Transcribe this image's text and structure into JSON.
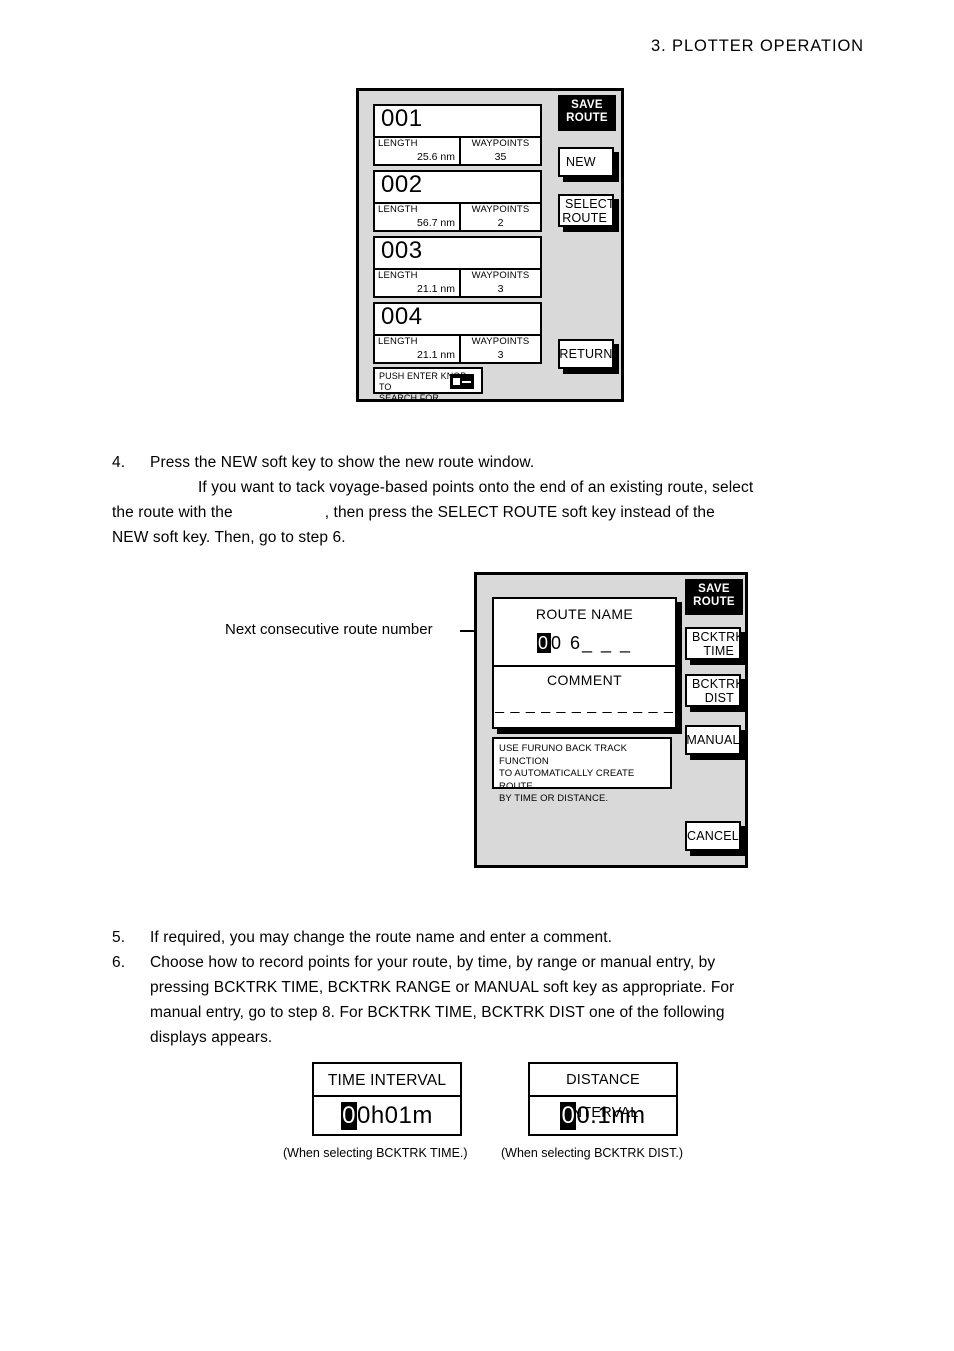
{
  "page": {
    "header": "3.  PLOTTER  OPERATION"
  },
  "figure_route_list": {
    "softkey_title": "SAVE\nROUTE",
    "softkey_title_line1": "SAVE",
    "softkey_title_line2": "ROUTE",
    "routes": [
      {
        "number": "001",
        "length_label": "LENGTH",
        "length_value": "25.6 nm",
        "waypoints_label": "WAYPOINTS",
        "waypoints_value": "35"
      },
      {
        "number": "002",
        "length_label": "LENGTH",
        "length_value": "56.7 nm",
        "waypoints_label": "WAYPOINTS",
        "waypoints_value": "2"
      },
      {
        "number": "003",
        "length_label": "LENGTH",
        "length_value": "21.1 nm",
        "waypoints_label": "WAYPOINTS",
        "waypoints_value": "3"
      },
      {
        "number": "004",
        "length_label": "LENGTH",
        "length_value": "21.1 nm",
        "waypoints_label": "WAYPOINTS",
        "waypoints_value": "3"
      }
    ],
    "search_hint_line1": "PUSH ENTER KNOB TO",
    "search_hint_line2": "SEARCH FOR",
    "softkeys": {
      "new": "NEW",
      "select_route_l1": "SELECT",
      "select_route_l2": "ROUTE",
      "return": "RETURN"
    }
  },
  "steps": {
    "step4_num": "4.",
    "step4_line1": "Press the NEW soft key to show the new route window.",
    "step4_line2": "If you want to tack voyage-based points onto the end of an existing route, select",
    "step4_line3_a": "the route with the",
    "step4_line3_b": ", then press the SELECT ROUTE soft key instead of the",
    "step4_line4": "NEW soft key. Then, go to step 6.",
    "step5_num": "5.",
    "step5_text": "If required, you may change the route name and enter a comment.",
    "step6_num": "6.",
    "step6_line1": "Choose how to record points for your route, by time, by range or manual entry, by",
    "step6_line2": "pressing BCKTRK TIME, BCKTRK RANGE or MANUAL soft key as appropriate. For",
    "step6_line3": "manual entry, go to step 8. For BCKTRK TIME, BCKTRK DIST one of the following",
    "step6_line4": "displays appears."
  },
  "figure_new_route": {
    "callout_label": "Next consecutive route number",
    "softkey_title_line1": "SAVE",
    "softkey_title_line2": "ROUTE",
    "route_name_label": "ROUTE NAME",
    "route_name_cursor_char": "0",
    "route_name_rest": "0 6",
    "route_name_blanks": "_ _ _",
    "comment_label": "COMMENT",
    "comment_blanks": "_ _ _ _ _ _ _ _ _ _ _ _",
    "hint_line1": "USE FURUNO BACK TRACK FUNCTION",
    "hint_line2": "TO AUTOMATICALLY CREATE ROUTE",
    "hint_line3": "BY TIME OR DISTANCE.",
    "softkeys": {
      "bcktrk_time_l1": "BCKTRK",
      "bcktrk_time_l2": "TIME",
      "bcktrk_dist_l1": "BCKTRK",
      "bcktrk_dist_l2": "DIST",
      "manual": "MANUAL",
      "cancel": "CANCEL"
    }
  },
  "figure_time_interval": {
    "title": "TIME INTERVAL",
    "cursor_char": "0",
    "value_rest": "0h01m",
    "caption": "(When selecting BCKTRK TIME.)"
  },
  "figure_distance_interval": {
    "title": "DISTANCE INTERVAL",
    "cursor_char": "0",
    "value_rest": "0.1nm",
    "caption": "(When selecting BCKTRK DIST.)"
  }
}
